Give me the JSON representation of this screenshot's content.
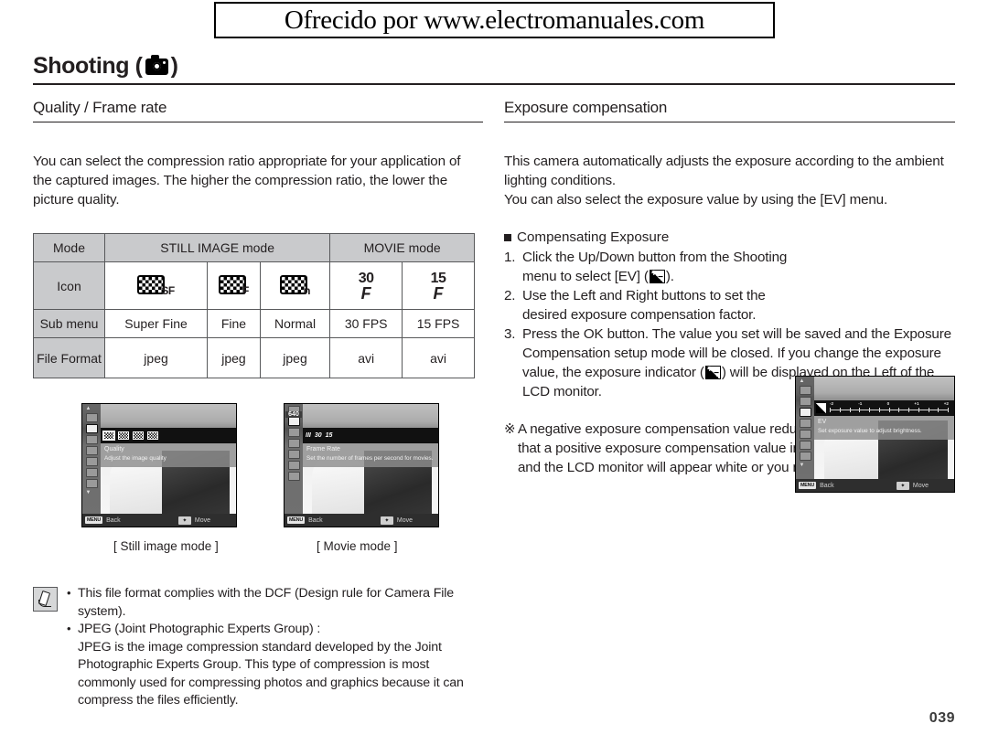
{
  "watermark": {
    "text": "Ofrecido por www.electromanuales.com"
  },
  "heading": {
    "title": "Shooting (",
    "title_close": ")",
    "camera_icon": "camera-icon"
  },
  "left": {
    "section_title": "Quality / Frame rate",
    "intro": "You can select the compression ratio appropriate for your application of the captured images. The higher the compression ratio, the lower the picture quality.",
    "table": {
      "row_labels": [
        "Mode",
        "Icon",
        "Sub menu",
        "File Format"
      ],
      "group_headers": [
        {
          "label": "STILL IMAGE mode",
          "span": 3
        },
        {
          "label": "MOVIE mode",
          "span": 2
        }
      ],
      "icons": [
        {
          "type": "quality",
          "letter": "SF"
        },
        {
          "type": "quality",
          "letter": "F"
        },
        {
          "type": "quality",
          "letter": "n"
        },
        {
          "type": "fps",
          "num": "30",
          "mark": "F"
        },
        {
          "type": "fps",
          "num": "15",
          "mark": "F"
        }
      ],
      "sub_menu": [
        "Super Fine",
        "Fine",
        "Normal",
        "30 FPS",
        "15 FPS"
      ],
      "file_format": [
        "jpeg",
        "jpeg",
        "jpeg",
        "avi",
        "avi"
      ]
    },
    "lcd_still": {
      "menu_title": "Quality",
      "menu_desc": "Adjust the image quality",
      "back_label": "Back",
      "move_label": "Move",
      "menu_button": "MENU"
    },
    "lcd_movie": {
      "resolution": "640",
      "menu_title": "Frame Rate",
      "menu_desc": "Set the number of frames per second for movies.",
      "back_label": "Back",
      "move_label": "Move",
      "menu_button": "MENU",
      "fps_options": [
        "III",
        "30",
        "15"
      ]
    },
    "captions": {
      "still": "[ Still image mode ]",
      "movie": "[ Movie mode ]"
    },
    "note": {
      "items": [
        "This file format complies with the DCF (Design rule for Camera File system).",
        "JPEG (Joint Photographic Experts Group) :"
      ],
      "continuation": "JPEG is the image compression standard developed by the Joint Photographic Experts Group. This type of compression is most commonly used for compressing photos and graphics because it can compress the files efficiently."
    }
  },
  "right": {
    "section_title": "Exposure compensation",
    "intro_line1": "This camera automatically adjusts the exposure according to the ambient lighting conditions.",
    "intro_line2": "You can also select the exposure value by using the [EV] menu.",
    "sub_head": "Compensating Exposure",
    "steps": [
      {
        "num": "1.",
        "pre": "Click the Up/Down button from the Shooting menu to select [EV] (",
        "post": ")."
      },
      {
        "num": "2.",
        "pre": "Use the Left and Right buttons to set the desired exposure compensation factor.",
        "post": ""
      },
      {
        "num": "3.",
        "pre": "Press the OK button. The value you set will be saved and the Exposure Compensation setup mode will be closed. If you change the exposure value, the exposure indicator (",
        "post": ") will be displayed on the Left of the LCD monitor."
      }
    ],
    "star_note": "A negative exposure compensation value reduces the exposure. Note that a positive exposure compensation value increases the exposure and the LCD monitor will appear white or you may not get good pictures.",
    "star_mark": "※",
    "lcd_ev": {
      "menu_title": "EV",
      "menu_desc": "Set exposure value to adjust brightness.",
      "scale_labels": [
        "-2",
        "-1",
        "0",
        "+1",
        "+2"
      ],
      "back_label": "Back",
      "move_label": "Move",
      "menu_button": "MENU"
    }
  },
  "footer": {
    "page_number": "039"
  }
}
